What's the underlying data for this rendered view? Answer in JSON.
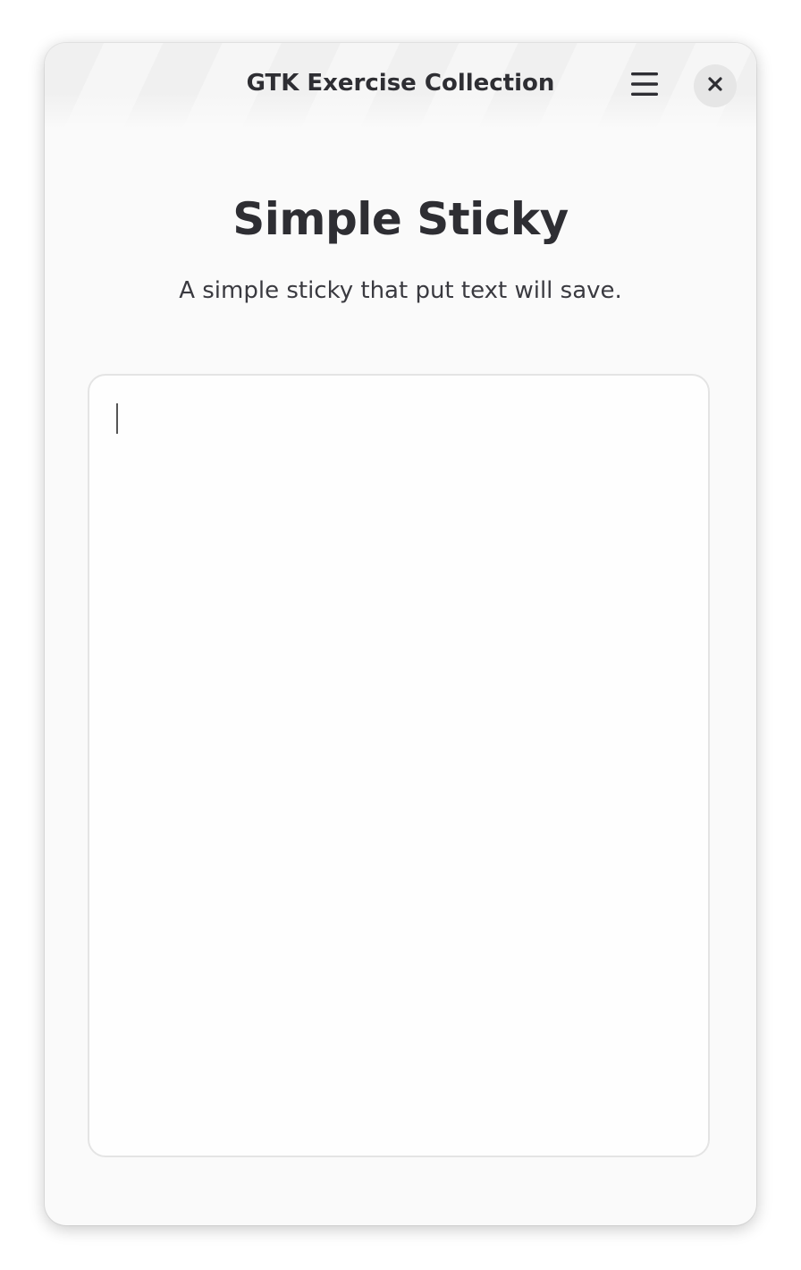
{
  "window": {
    "title": "GTK Exercise Collection"
  },
  "header": {
    "menu_icon": "hamburger-menu-icon",
    "close_icon": "close-icon"
  },
  "main": {
    "title": "Simple Sticky",
    "subtitle": "A simple sticky that put text will save.",
    "text_value": ""
  },
  "colors": {
    "window_bg": "#fafafa",
    "text_primary": "#2e2e33",
    "close_button_bg": "#e6e6e6"
  }
}
